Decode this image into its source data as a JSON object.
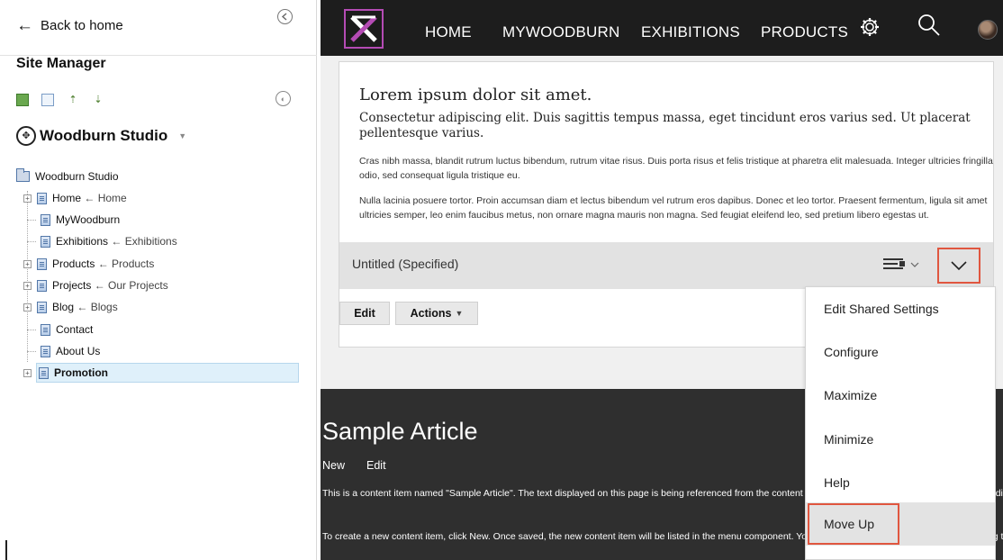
{
  "sidebar": {
    "back_label": "Back to home",
    "collapse_glyph": "⊝",
    "title": "Site Manager",
    "site_name": "Woodburn Studio",
    "tree": {
      "root": "Woodburn Studio",
      "nodes": [
        {
          "label": "Home",
          "alias": "Home"
        },
        {
          "label": "MyWoodburn",
          "alias": ""
        },
        {
          "label": "Exhibitions",
          "alias": "Exhibitions"
        },
        {
          "label": "Products",
          "alias": "Products"
        },
        {
          "label": "Projects",
          "alias": "Our Projects"
        },
        {
          "label": "Blog",
          "alias": "Blogs"
        },
        {
          "label": "Contact",
          "alias": ""
        },
        {
          "label": "About Us",
          "alias": ""
        },
        {
          "label": "Promotion",
          "alias": ""
        }
      ],
      "alias_arrow": "←",
      "selected": "Promotion"
    }
  },
  "nav": {
    "items": [
      "HOME",
      "MYWOODBURN",
      "EXHIBITIONS",
      "PRODUCTS"
    ],
    "icons": [
      "gear-icon",
      "search-icon",
      "avatar"
    ],
    "accent": "#b44bb4",
    "background": "#1d1d1d"
  },
  "portlet": {
    "heading": "Lorem ipsum dolor sit amet.",
    "lead": "Consectetur adipiscing elit. Duis sagittis tempus massa, eget tincidunt eros varius sed. Ut placerat pellentesque varius.",
    "para1": "Cras nibh massa, blandit rutrum luctus bibendum, rutrum vitae risus. Duis porta risus et felis tristique at pharetra elit malesuada. Integer ultricies fringilla odio, sed consequat ligula tristique eu.",
    "para2": "Nulla lacinia posuere tortor. Proin accumsan diam et lectus bibendum vel rutrum eros dapibus. Donec et leo tortor. Praesent fermentum, ligula sit amet ultricies semper, leo enim faucibus metus, non ornare magna mauris non magna. Sed feugiat eleifend leo, sed pretium libero egestas ut.",
    "untitled_label": "Untitled (Specified)",
    "edit_label": "Edit",
    "actions_label": "Actions",
    "highlight_color": "#e0563f"
  },
  "article": {
    "title": "Sample Article",
    "new_label": "New",
    "edit_label": "Edit",
    "line1": "This is a content item named \"Sample Article\". The text displayed on this page is being referenced from the content item, which is stored in this content item. To edit this content item, click Edit.",
    "line2": "To create a new content item, click New. Once saved, the new content item will be listed in the menu component. You can edit this menu component by accessing the authoring portlet located under Applications > Content."
  },
  "dropdown": {
    "items": [
      "Edit Shared Settings",
      "Configure",
      "Maximize",
      "Minimize",
      "Help",
      "Move Up"
    ],
    "highlighted": "Move Up"
  }
}
